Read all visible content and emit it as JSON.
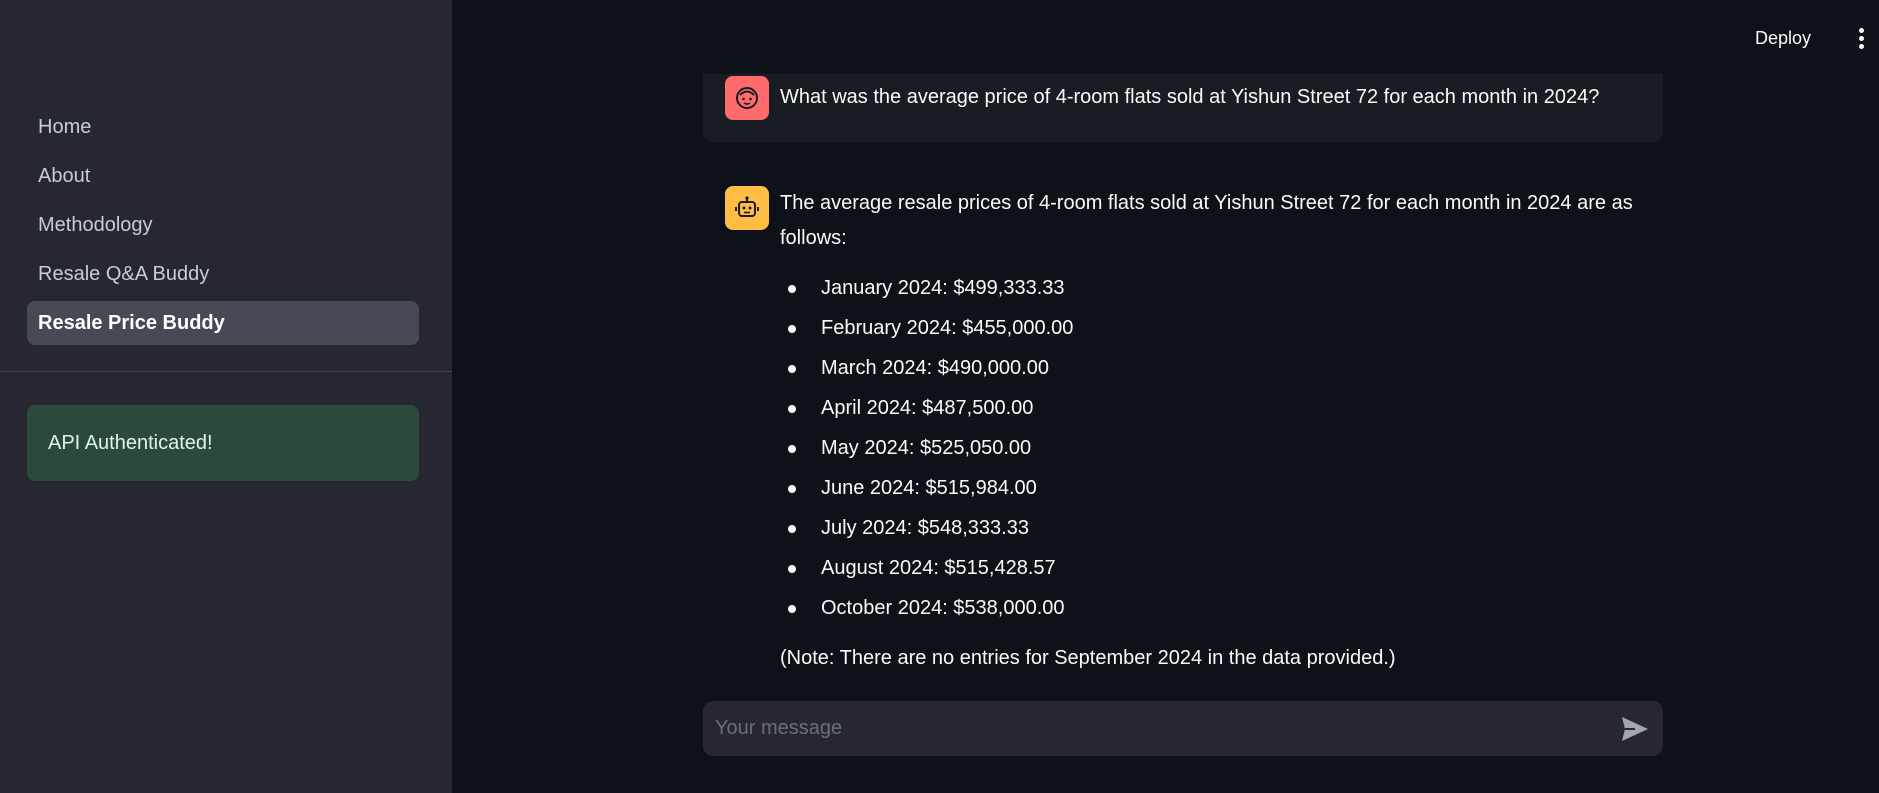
{
  "sidebar": {
    "nav": [
      {
        "label": "Home"
      },
      {
        "label": "About"
      },
      {
        "label": "Methodology"
      },
      {
        "label": "Resale Q&A Buddy"
      },
      {
        "label": "Resale Price Buddy"
      }
    ],
    "alert": "API Authenticated!"
  },
  "header": {
    "deploy_label": "Deploy",
    "menu_icon": "more-vertical-icon"
  },
  "chat": {
    "user_message": "What was the average price of 4-room flats sold at Yishun Street 72 for each month in 2024?",
    "assistant": {
      "intro_line1": "The average resale prices of 4-room flats sold at Yishun Street 72 for each month in 2024 are as",
      "intro_line2": "follows:",
      "items": [
        "January 2024: $499,333.33",
        "February 2024: $455,000.00",
        "March 2024: $490,000.00",
        "April 2024: $487,500.00",
        "May 2024: $525,050.00",
        "June 2024: $515,984.00",
        "July 2024: $548,333.33",
        "August 2024: $515,428.57",
        "October 2024: $538,000.00"
      ],
      "note": "(Note: There are no entries for September 2024 in the data provided.)"
    }
  },
  "input": {
    "placeholder": "Your message",
    "send_icon": "send-icon"
  },
  "colors": {
    "background": "#0e1117",
    "sidebar": "#262730",
    "user_avatar": "#ff6b6b",
    "bot_avatar": "#ffbd45",
    "alert_bg": "#2c4a3b"
  }
}
